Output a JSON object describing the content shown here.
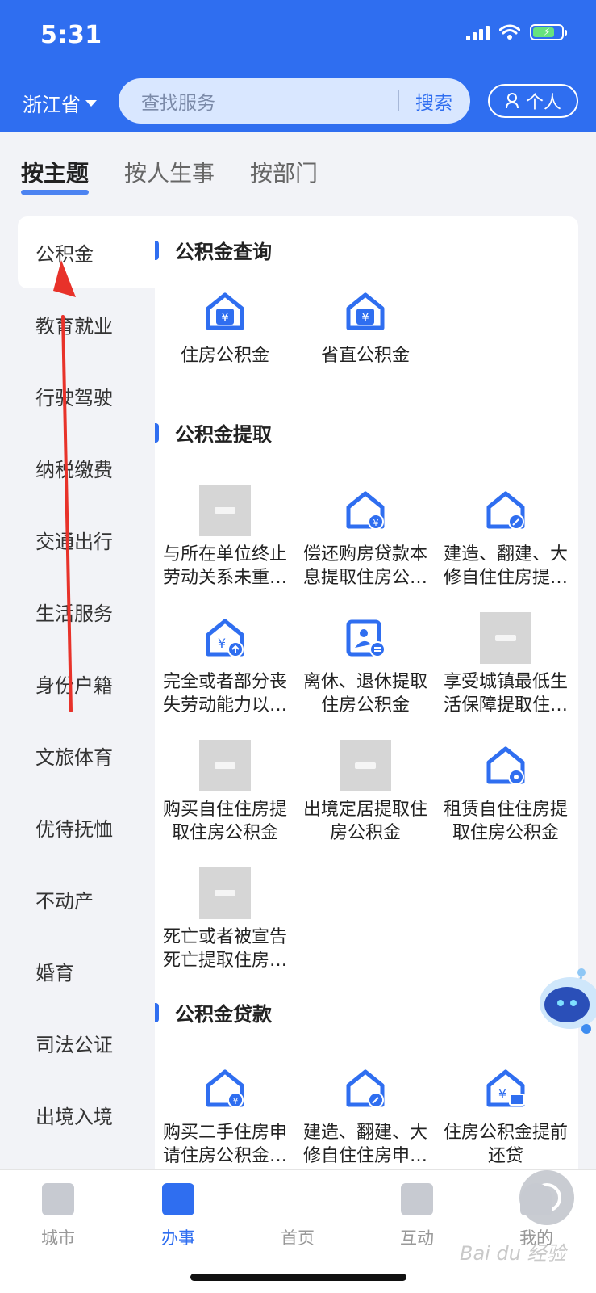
{
  "status": {
    "time": "5:31"
  },
  "header": {
    "province": "浙江省",
    "search_placeholder": "查找服务",
    "search_button": "搜索",
    "personal": "个人"
  },
  "tabs": [
    "按主题",
    "按人生事",
    "按部门"
  ],
  "sidebar": {
    "items": [
      "公积金",
      "教育就业",
      "行驶驾驶",
      "纳税缴费",
      "交通出行",
      "生活服务",
      "身份户籍",
      "文旅体育",
      "优待抚恤",
      "不动产",
      "婚育",
      "司法公证",
      "出境入境"
    ]
  },
  "sections": [
    {
      "title": "公积金查询",
      "items": [
        "住房公积金",
        "省直公积金"
      ]
    },
    {
      "title": "公积金提取",
      "items": [
        "与所在单位终止劳动关系未重新就业提取住房公积金",
        "偿还购房贷款本息提取住房公积金",
        "建造、翻建、大修自住住房提取住房公积金",
        "完全或者部分丧失劳动能力以致与单位终止劳动关系提取住房公积金",
        "离休、退休提取住房公积金",
        "享受城镇最低生活保障提取住房公积金",
        "购买自住住房提取住房公积金",
        "出境定居提取住房公积金",
        "租赁自住住房提取住房公积金",
        "死亡或者被宣告死亡提取住房公积金"
      ]
    },
    {
      "title": "公积金贷款",
      "items": [
        "购买二手住房申请住房公积金贷款",
        "建造、翻建、大修自住住房申请住房公积金贷款",
        "住房公积金提前还贷"
      ]
    }
  ],
  "bottom_nav": [
    "城市",
    "办事",
    "首页",
    "互动",
    "我的"
  ],
  "watermark": "Bai du 经验",
  "colors": {
    "primary": "#2f6ef0",
    "arrow": "#e8322a"
  }
}
